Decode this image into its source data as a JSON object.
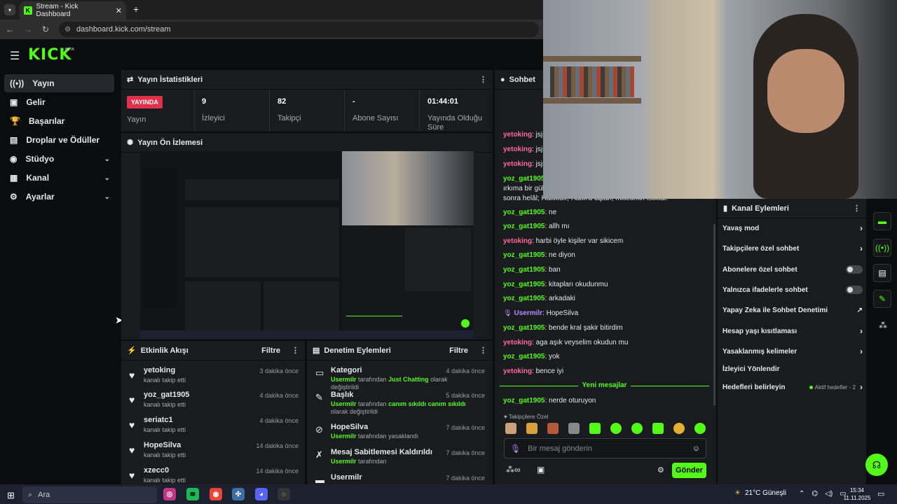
{
  "browser": {
    "tab_title": "Stream - Kick Dashboard",
    "url": "dashboard.kick.com/stream",
    "new_tab": "+"
  },
  "brand": {
    "logo": "KICK",
    "beta": "BETA",
    "accent": "#53fc18"
  },
  "sidebar": {
    "items": [
      {
        "label": "Yayın",
        "icon": "broadcast-icon"
      },
      {
        "label": "Gelir",
        "icon": "money-icon"
      },
      {
        "label": "Başarılar",
        "icon": "trophy-icon"
      },
      {
        "label": "Droplar ve Ödüller",
        "icon": "gift-icon"
      },
      {
        "label": "Stüdyo",
        "icon": "studio-icon"
      },
      {
        "label": "Kanal",
        "icon": "channel-icon"
      },
      {
        "label": "Ayarlar",
        "icon": "gear-icon"
      }
    ]
  },
  "stats": {
    "title": "Yayın İstatistikleri",
    "live_badge": "YAYINDA",
    "live_label": "Yayın",
    "viewers_value": "9",
    "viewers_label": "İzleyici",
    "followers_value": "82",
    "followers_label": "Takipçi",
    "subs_value": "-",
    "subs_label": "Abone Sayısı",
    "duration_value": "01:44:01",
    "duration_label1": "Yayında Olduğu",
    "duration_label2": "Süre"
  },
  "preview": {
    "title": "Yayın Ön İzlemesi"
  },
  "activity": {
    "title": "Etkinlik Akışı",
    "filter": "Filtre",
    "events": [
      {
        "name": "yetoking",
        "sub": "kanalı takip etti",
        "time": "3 dakika önce"
      },
      {
        "name": "yoz_gat1905",
        "sub": "kanalı takip etti",
        "time": "4 dakika önce"
      },
      {
        "name": "seriatc1",
        "sub": "kanalı takip etti",
        "time": "4 dakika önce"
      },
      {
        "name": "HopeSilva",
        "sub": "kanalı takip etti",
        "time": "14 dakika önce"
      },
      {
        "name": "xzecc0",
        "sub": "kanalı takip etti",
        "time": "14 dakika önce"
      }
    ]
  },
  "moderation": {
    "title": "Denetim Eylemleri",
    "filter": "Filtre",
    "items": [
      {
        "name": "Kategori",
        "user": "Usermilr",
        "mid": " tarafından ",
        "hl": "Just Chatting",
        "rest": " olarak değiştirildi",
        "time": "4 dakika önce"
      },
      {
        "name": "Başlık",
        "user": "Usermilr",
        "mid": " tarafından ",
        "hl": "canım sıkıldı canım sıkıldı",
        "rest": " olarak değiştirildi",
        "time": "5 dakika önce"
      },
      {
        "name": "HopeSilva",
        "user": "Usermilr",
        "mid": " tarafından yasaklandı",
        "hl": "",
        "rest": "",
        "time": "7 dakika önce"
      },
      {
        "name": "Mesaj Sabitlemesi Kaldırıldı",
        "user": "Usermilr",
        "mid": " tarafından",
        "hl": "",
        "rest": "",
        "time": "7 dakika önce"
      },
      {
        "name": "Usermilr",
        "user": "",
        "mid": "",
        "hl": "",
        "rest": "",
        "time": "7 dakika önce"
      }
    ]
  },
  "chat": {
    "title": "Sohbet",
    "messages": [
      {
        "user": "yetoking",
        "text": ": jsjs",
        "color": "pink"
      },
      {
        "user": "yetoking",
        "text": ": jsjs",
        "color": "pink"
      },
      {
        "user": "yetoking",
        "text": ": jsjs",
        "color": "pink"
      },
      {
        "user": "yoz_gat1905",
        "text": ":",
        "color": "grn"
      },
      {
        "user": "",
        "text": "ırkıma bir gül",
        "color": ""
      },
      {
        "user": "",
        "text": "sonra helâl; Hakkıdır, Hakk'a tapan, milletimin istiklâl.",
        "color": ""
      },
      {
        "user": "yoz_gat1905",
        "text": ": ne",
        "color": "grn"
      },
      {
        "user": "yoz_gat1905",
        "text": ": allh mı",
        "color": "grn"
      },
      {
        "user": "yetoking",
        "text": ": harbi öyle kişiler var sikicem",
        "color": "pink"
      },
      {
        "user": "yoz_gat1905",
        "text": ": ne diyon",
        "color": "grn"
      },
      {
        "user": "yoz_gat1905",
        "text": ": ban",
        "color": "grn"
      },
      {
        "user": "yoz_gat1905",
        "text": ": kitapları okudunmu",
        "color": "grn"
      },
      {
        "user": "yoz_gat1905",
        "text": ": arkadaki",
        "color": "grn"
      },
      {
        "user": "Usermilr",
        "text": ": HopeSilva",
        "color": "purp"
      },
      {
        "user": "yoz_gat1905",
        "text": ": bende kral şakir bitirdim",
        "color": "grn"
      },
      {
        "user": "yetoking",
        "text": ": aga aşık veyselim okudun mu",
        "color": "pink"
      },
      {
        "user": "yoz_gat1905",
        "text": ": yok",
        "color": "grn"
      },
      {
        "user": "yetoking",
        "text": ": bence iyi",
        "color": "pink"
      }
    ],
    "new_messages": "Yeni mesajlar",
    "last": {
      "user": "yoz_gat1905",
      "text": ": nerde oturuyon"
    },
    "followers_only": "Takipçilere Özel",
    "input_placeholder": "Bir mesaj gönderin",
    "send": "Gönder"
  },
  "channel_actions": {
    "title": "Kanal Eylemleri",
    "items": [
      {
        "label": "Yavaş mod",
        "kind": "arrow"
      },
      {
        "label": "Takipçilere özel sohbet",
        "kind": "arrow"
      },
      {
        "label": "Abonelere özel sohbet",
        "kind": "toggle"
      },
      {
        "label": "Yalnızca ifadelerle sohbet",
        "kind": "toggle"
      },
      {
        "label": "Yapay Zeka ile Sohbet Denetimi",
        "kind": "ext"
      },
      {
        "label": "Hesap yaşı kısıtlaması",
        "kind": "arrow"
      },
      {
        "label": "Yasaklanmış kelimeler",
        "kind": "arrow"
      },
      {
        "label": "İzleyici Yönlendir",
        "kind": "none"
      },
      {
        "label": "Hedefleri belirleyin",
        "kind": "goal"
      }
    ],
    "goal_text": "Aktif hedefler - 2"
  },
  "taskbar": {
    "search": "Ara",
    "weather": "21°C  Güneşli",
    "time": "15:34",
    "date": "11.11.2025"
  }
}
